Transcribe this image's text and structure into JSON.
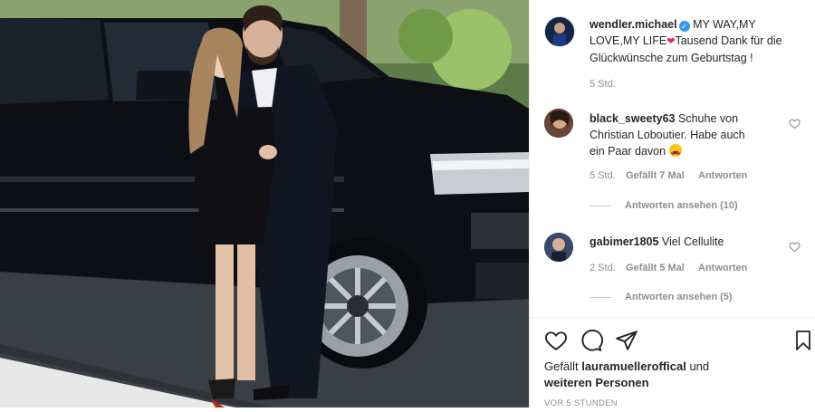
{
  "post": {
    "username": "wendler.michael",
    "caption_line1": "MY WAY,MY",
    "caption_line2": "LOVE,MY LIFE",
    "caption_line2b": "Tausend Dank für die",
    "caption_line3": "Glückwünsche zum Geburtstag !",
    "time": "5 Std."
  },
  "comments": [
    {
      "username": "black_sweety63",
      "text_line1": "Schuhe von",
      "text_line2": "Christian Loboutier. Habe auch",
      "text_line3": "ein Paar davon",
      "time": "5 Std.",
      "likes": "Gefällt 7 Mal",
      "reply": "Antworten",
      "view_replies": "Antworten ansehen (10)"
    },
    {
      "username": "gabimer1805",
      "text_line1": "Viel Cellulite",
      "time": "2 Std.",
      "likes": "Gefällt 5 Mal",
      "reply": "Antworten",
      "view_replies": "Antworten ansehen (5)"
    }
  ],
  "likes_line": {
    "prefix": "Gefällt",
    "user": "lauramuelleroffical",
    "suffix": "und",
    "others": "weiteren Personen"
  },
  "timestamp": "VOR 5 STUNDEN",
  "icons": [
    "heart-icon",
    "comment-icon",
    "share-icon",
    "bookmark-icon",
    "verified-badge-icon",
    "heart-eyes-emoji-icon",
    "heart-emoji-icon"
  ]
}
